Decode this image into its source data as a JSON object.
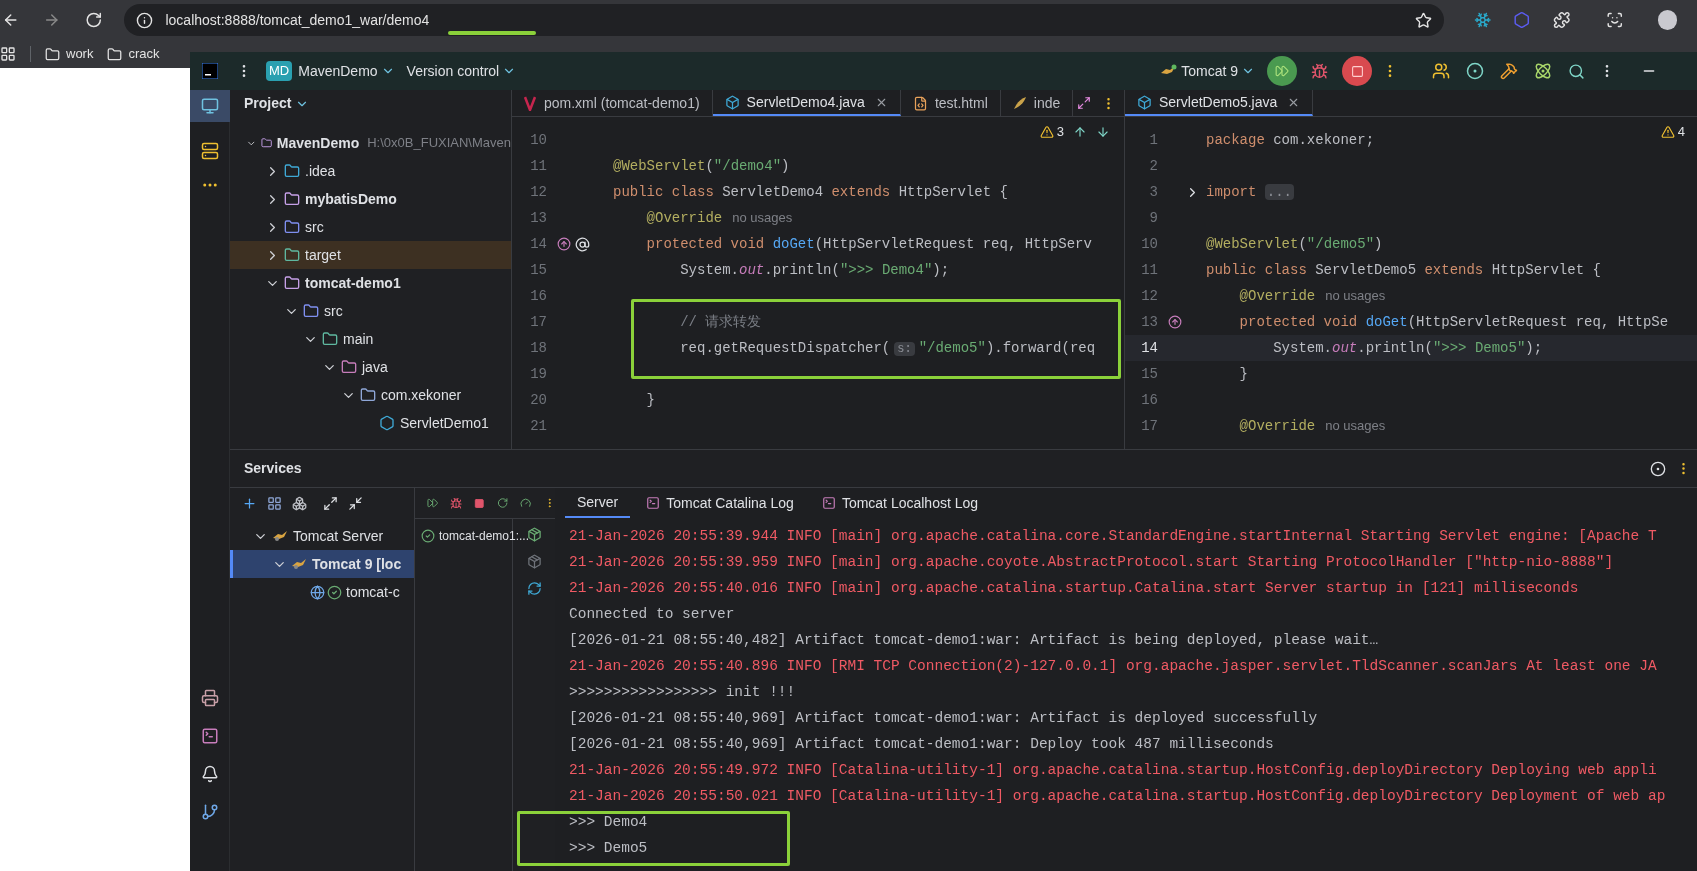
{
  "browser": {
    "url": "localhost:8888/tomcat_demo1_war/demo4",
    "bookmarks": [
      "work",
      "crack"
    ]
  },
  "ide": {
    "title_bar": {
      "project_badge": "MD",
      "project": "MavenDemo",
      "vcs": "Version control",
      "run_config": "Tomcat 9"
    },
    "project_panel": {
      "title": "Project",
      "tree": [
        {
          "name": "MavenDemo",
          "path": "H:\\0x0B_FUXIAN\\Maven",
          "kind": "module",
          "expanded": true,
          "children": [
            {
              "name": ".idea",
              "kind": "config",
              "expanded": false
            },
            {
              "name": "mybatisDemo",
              "kind": "module",
              "expanded": false
            },
            {
              "name": "src",
              "kind": "source",
              "expanded": false
            },
            {
              "name": "target",
              "kind": "excluded",
              "expanded": false
            },
            {
              "name": "tomcat-demo1",
              "kind": "module",
              "expanded": true,
              "children": [
                {
                  "name": "src",
                  "kind": "source",
                  "expanded": true,
                  "children": [
                    {
                      "name": "main",
                      "kind": "folder",
                      "expanded": true,
                      "children": [
                        {
                          "name": "java",
                          "kind": "sources_root",
                          "expanded": true,
                          "children": [
                            {
                              "name": "com.xekoner",
                              "kind": "package",
                              "expanded": true,
                              "children": [
                                {
                                  "name": "ServletDemo1",
                                  "kind": "class"
                                }
                              ]
                            }
                          ]
                        }
                      ]
                    }
                  ]
                }
              ]
            }
          ]
        }
      ]
    },
    "left_editor": {
      "tabs": [
        {
          "label": "pom.xml (tomcat-demo1)",
          "kind": "maven",
          "selected": false
        },
        {
          "label": "ServletDemo4.java",
          "kind": "java",
          "selected": true
        },
        {
          "label": "test.html",
          "kind": "html",
          "selected": false
        },
        {
          "label": "inde",
          "kind": "other",
          "selected": false
        }
      ],
      "warnings": "3",
      "lines": [
        {
          "number": "10",
          "kind": "code",
          "current": false
        },
        {
          "number": "11",
          "kind": "code",
          "current": false,
          "segments": [
            {
              "kind": "annotation",
              "text": "@WebServlet"
            },
            {
              "kind": "plain",
              "text": "("
            },
            {
              "kind": "string",
              "text": "\"/demo4\""
            },
            {
              "kind": "plain",
              "text": ")"
            }
          ]
        },
        {
          "number": "12",
          "kind": "code",
          "current": false,
          "segments": [
            {
              "kind": "keyword",
              "text": "public class "
            },
            {
              "kind": "plain",
              "text": "ServletDemo4 "
            },
            {
              "kind": "keyword",
              "text": "extends "
            },
            {
              "kind": "plain",
              "text": "HttpServlet {"
            }
          ]
        },
        {
          "number": "13",
          "kind": "code",
          "current": false,
          "segments": [
            {
              "kind": "annotation",
              "text": "    @Override"
            },
            {
              "kind": "hint",
              "text": "no usages"
            }
          ]
        },
        {
          "number": "14",
          "kind": "override_annotated",
          "current": false,
          "segments": [
            {
              "kind": "keyword",
              "text": "    protected void "
            },
            {
              "kind": "method",
              "text": "doGet"
            },
            {
              "kind": "plain",
              "text": "(HttpServletRequest req, HttpServ"
            }
          ]
        },
        {
          "number": "15",
          "kind": "code",
          "current": false,
          "segments": [
            {
              "kind": "plain",
              "text": "        System."
            },
            {
              "kind": "field",
              "text": "out"
            },
            {
              "kind": "plain",
              "text": ".println("
            },
            {
              "kind": "string",
              "text": "\">>> Demo4\""
            },
            {
              "kind": "plain",
              "text": ");"
            }
          ]
        },
        {
          "number": "16",
          "kind": "code",
          "current": false
        },
        {
          "number": "17",
          "kind": "code",
          "current": false,
          "segments": [
            {
              "kind": "comment",
              "text": "        // 请求转发"
            }
          ]
        },
        {
          "number": "18",
          "kind": "code",
          "current": false,
          "segments": [
            {
              "kind": "plain",
              "text": "        req.getRequestDispatcher("
            },
            {
              "kind": "param",
              "text": "s:"
            },
            {
              "kind": "string",
              "text": "\"/demo5\""
            },
            {
              "kind": "plain",
              "text": ").forward(req"
            }
          ]
        },
        {
          "number": "19",
          "kind": "code",
          "current": false
        },
        {
          "number": "20",
          "kind": "code",
          "current": false,
          "segments": [
            {
              "kind": "plain",
              "text": "    }"
            }
          ]
        },
        {
          "number": "21",
          "kind": "code",
          "current": false
        }
      ]
    },
    "right_editor": {
      "tabs": [
        {
          "label": "ServletDemo5.java",
          "kind": "java",
          "selected": true
        }
      ],
      "warnings": "4",
      "lines": [
        {
          "number": "1",
          "kind": "code",
          "current": false,
          "segments": [
            {
              "kind": "keyword",
              "text": "package "
            },
            {
              "kind": "plain",
              "text": "com.xekoner;"
            }
          ]
        },
        {
          "number": "2",
          "kind": "code",
          "current": false
        },
        {
          "number": "3",
          "kind": "fold",
          "current": false,
          "segments": [
            {
              "kind": "keyword",
              "text": "import "
            },
            {
              "kind": "fold",
              "text": "..."
            }
          ]
        },
        {
          "number": "9",
          "kind": "code",
          "current": false
        },
        {
          "number": "10",
          "kind": "code",
          "current": false,
          "segments": [
            {
              "kind": "annotation",
              "text": "@WebServlet"
            },
            {
              "kind": "plain",
              "text": "("
            },
            {
              "kind": "string",
              "text": "\"/demo5\""
            },
            {
              "kind": "plain",
              "text": ")"
            }
          ]
        },
        {
          "number": "11",
          "kind": "code",
          "current": false,
          "segments": [
            {
              "kind": "keyword",
              "text": "public class "
            },
            {
              "kind": "plain",
              "text": "ServletDemo5 "
            },
            {
              "kind": "keyword",
              "text": "extends "
            },
            {
              "kind": "plain",
              "text": "HttpServlet {"
            }
          ]
        },
        {
          "number": "12",
          "kind": "code",
          "current": false,
          "segments": [
            {
              "kind": "annotation",
              "text": "    @Override"
            },
            {
              "kind": "hint",
              "text": "no usages"
            }
          ]
        },
        {
          "number": "13",
          "kind": "override",
          "current": false,
          "segments": [
            {
              "kind": "keyword",
              "text": "    protected void "
            },
            {
              "kind": "method",
              "text": "doGet"
            },
            {
              "kind": "plain",
              "text": "(HttpServletRequest req, HttpSe"
            }
          ]
        },
        {
          "number": "14",
          "kind": "code",
          "current": true,
          "segments": [
            {
              "kind": "plain",
              "text": "        System."
            },
            {
              "kind": "field",
              "text": "out"
            },
            {
              "kind": "plain",
              "text": ".println("
            },
            {
              "kind": "string",
              "text": "\">>> Demo5\""
            },
            {
              "kind": "plain",
              "text": ");"
            }
          ]
        },
        {
          "number": "15",
          "kind": "code",
          "current": false,
          "segments": [
            {
              "kind": "plain",
              "text": "    }"
            }
          ]
        },
        {
          "number": "16",
          "kind": "code",
          "current": false
        },
        {
          "number": "17",
          "kind": "code",
          "current": false,
          "segments": [
            {
              "kind": "annotation",
              "text": "    @Override"
            },
            {
              "kind": "hint",
              "text": "no usages"
            }
          ]
        }
      ]
    },
    "services": {
      "title": "Services",
      "tree": [
        {
          "label": "Tomcat Server",
          "bold": false,
          "expanded": true,
          "selected": false,
          "children": [
            {
              "label": "Tomcat 9 [loc",
              "bold": true,
              "expanded": true,
              "selected": true,
              "children": [
                {
                  "label": "tomcat-c",
                  "bold": false,
                  "selected": false
                }
              ]
            }
          ]
        }
      ],
      "deployments": [
        "tomcat-demo1:..."
      ],
      "console_tabs": [
        {
          "label": "Server",
          "kind": "plain",
          "selected": true
        },
        {
          "label": "Tomcat Catalina Log",
          "kind": "log",
          "selected": false
        },
        {
          "label": "Tomcat Localhost Log",
          "kind": "log",
          "selected": false
        }
      ],
      "console": [
        {
          "kind": "error",
          "text": "21-Jan-2026 20:55:39.944 INFO [main] org.apache.catalina.core.StandardEngine.startInternal Starting Servlet engine: [Apache T"
        },
        {
          "kind": "error",
          "text": "21-Jan-2026 20:55:39.959 INFO [main] org.apache.coyote.AbstractProtocol.start Starting ProtocolHandler [\"http-nio-8888\"]"
        },
        {
          "kind": "error",
          "text": "21-Jan-2026 20:55:40.016 INFO [main] org.apache.catalina.startup.Catalina.start Server startup in [121] milliseconds"
        },
        {
          "kind": "output",
          "text": "Connected to server"
        },
        {
          "kind": "output",
          "text": "[2026-01-21 08:55:40,482] Artifact tomcat-demo1:war: Artifact is being deployed, please wait…"
        },
        {
          "kind": "error",
          "text": "21-Jan-2026 20:55:40.896 INFO [RMI TCP Connection(2)-127.0.0.1] org.apache.jasper.servlet.TldScanner.scanJars At least one JA"
        },
        {
          "kind": "output",
          "text": ">>>>>>>>>>>>>>>>> init !!!"
        },
        {
          "kind": "output",
          "text": "[2026-01-21 08:55:40,969] Artifact tomcat-demo1:war: Artifact is deployed successfully"
        },
        {
          "kind": "output",
          "text": "[2026-01-21 08:55:40,969] Artifact tomcat-demo1:war: Deploy took 487 milliseconds"
        },
        {
          "kind": "error",
          "text": "21-Jan-2026 20:55:49.972 INFO [Catalina-utility-1] org.apache.catalina.startup.HostConfig.deployDirectory Deploying web appli"
        },
        {
          "kind": "error",
          "text": "21-Jan-2026 20:55:50.021 INFO [Catalina-utility-1] org.apache.catalina.startup.HostConfig.deployDirectory Deployment of web ap"
        },
        {
          "kind": "output",
          "text": ">>> Demo4"
        },
        {
          "kind": "output",
          "text": ">>> Demo5"
        }
      ]
    }
  }
}
